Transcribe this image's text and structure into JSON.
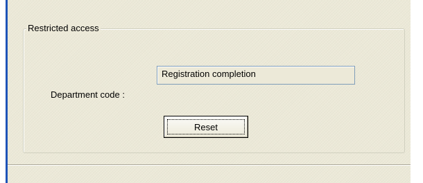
{
  "group": {
    "title": "Restricted access"
  },
  "department": {
    "label": "Department code :",
    "value": "Registration completion"
  },
  "actions": {
    "reset_label": "Reset"
  },
  "colors": {
    "panel_background": "#ece9d8",
    "accent_bar": "#1d53b8",
    "field_border": "#7f9db9"
  }
}
